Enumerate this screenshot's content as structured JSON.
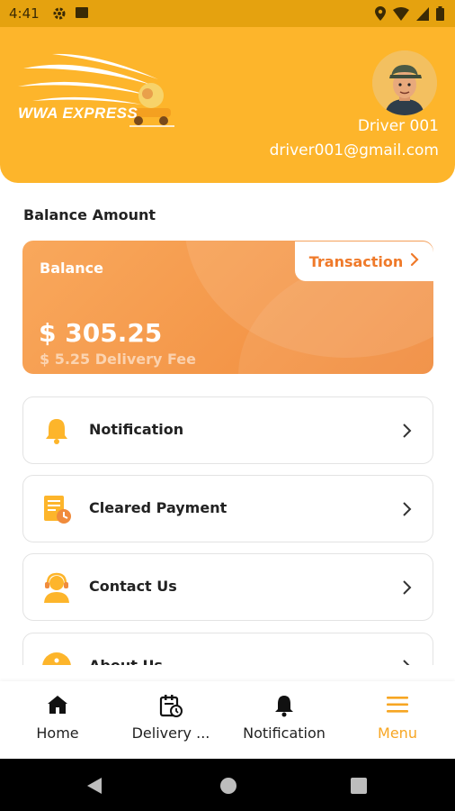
{
  "status_bar": {
    "time": "4:41"
  },
  "header": {
    "logo_text": "WWA EXPRESS",
    "driver_name": "Driver 001",
    "driver_email": "driver001@gmail.com"
  },
  "balance_section": {
    "title": "Balance Amount",
    "card_label": "Balance",
    "amount": "$ 305.25",
    "fee": "$ 5.25 Delivery Fee",
    "transaction_label": "Transaction"
  },
  "menu": {
    "items": [
      {
        "label": "Notification",
        "icon": "bell-icon"
      },
      {
        "label": "Cleared Payment",
        "icon": "receipt-icon"
      },
      {
        "label": "Contact Us",
        "icon": "support-agent-icon"
      },
      {
        "label": "About Us",
        "icon": "info-icon"
      }
    ]
  },
  "bottom_nav": {
    "items": [
      {
        "label": "Home",
        "icon": "home-icon"
      },
      {
        "label": "Delivery ...",
        "icon": "delivery-schedule-icon"
      },
      {
        "label": "Notification",
        "icon": "bell-icon"
      },
      {
        "label": "Menu",
        "icon": "menu-icon"
      }
    ],
    "active": "Menu"
  },
  "colors": {
    "brand_yellow": "#fdb52b",
    "status_bar": "#e5a20f",
    "balance_orange": "#f08b3c",
    "accent_orange": "#ef7a2a",
    "active_nav": "#f7a623"
  }
}
